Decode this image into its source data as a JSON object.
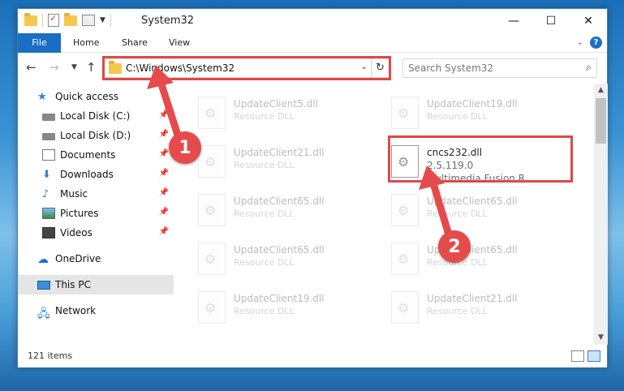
{
  "window": {
    "title": "System32"
  },
  "ribbon": {
    "tabs": [
      "File",
      "Home",
      "Share",
      "View"
    ]
  },
  "address_bar": {
    "path": "C:\\Windows\\System32"
  },
  "search": {
    "placeholder": "Search System32"
  },
  "nav_pane": {
    "quick_access": "Quick access",
    "items": [
      {
        "label": "Local Disk (C:)",
        "icon": "drive-icon",
        "pinned": true
      },
      {
        "label": "Local Disk (D:)",
        "icon": "drive-icon",
        "pinned": true
      },
      {
        "label": "Documents",
        "icon": "documents-icon",
        "pinned": true
      },
      {
        "label": "Downloads",
        "icon": "downloads-icon",
        "pinned": true
      },
      {
        "label": "Music",
        "icon": "music-icon",
        "pinned": true
      },
      {
        "label": "Pictures",
        "icon": "pictures-icon",
        "pinned": true
      },
      {
        "label": "Videos",
        "icon": "videos-icon",
        "pinned": true
      }
    ],
    "onedrive": "OneDrive",
    "this_pc": "This PC",
    "network": "Network"
  },
  "files": {
    "row1_left": {
      "name": "UpdateClient5.dll",
      "desc": "Resource DLL"
    },
    "row1_right": {
      "name": "UpdateClient19.dll",
      "desc": "Resource DLL"
    },
    "row2_left": {
      "name": "UpdateClient21.dll",
      "desc": "Resource DLL"
    },
    "highlighted": {
      "name": "cncs232.dll",
      "version": "2.5.119.0",
      "desc": "Multimedia Fusion R..."
    },
    "row3_left": {
      "name": "UpdateClient65.dll",
      "desc": "Resource DLL"
    },
    "row3_right": {
      "name": "UpdateClient65.dll",
      "desc": "Resource DLL"
    },
    "row4_left": {
      "name": "UpdateClient65.dll",
      "desc": "Resource DLL"
    },
    "row4_right": {
      "name": "UpdateClient65.dll",
      "desc": "Resource DLL"
    },
    "row5_left": {
      "name": "UpdateClient19.dll",
      "desc": "Resource DLL"
    },
    "row5_right": {
      "name": "UpdateClient21.dll",
      "desc": "Resource DLL"
    }
  },
  "status": {
    "item_count": "121 items"
  },
  "annotations": {
    "step1": "1",
    "step2": "2"
  },
  "colors": {
    "accent": "#1a6fc4",
    "highlight": "#e04848"
  }
}
